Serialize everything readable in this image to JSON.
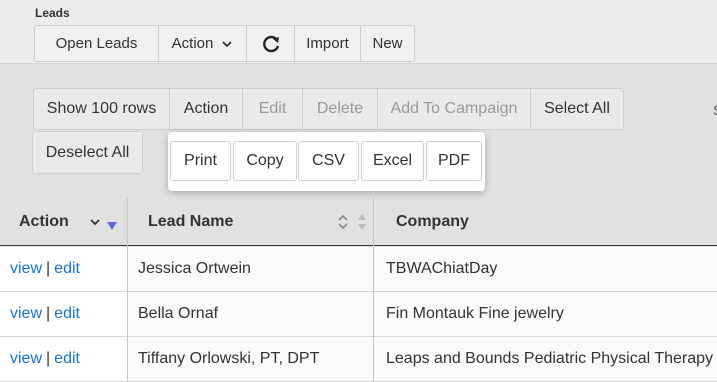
{
  "header": {
    "title": "Leads"
  },
  "top_toolbar": {
    "open_leads_label": "Open Leads",
    "action_label": "Action",
    "refresh_icon": "refresh-icon",
    "import_label": "Import",
    "new_label": "New"
  },
  "list_toolbar": {
    "show_rows_label": "Show 100 rows",
    "action_label": "Action",
    "edit_label": "Edit",
    "delete_label": "Delete",
    "add_to_campaign_label": "Add To Campaign",
    "select_all_label": "Select All",
    "deselect_all_label": "Deselect All",
    "partial_label": "S"
  },
  "export_menu": {
    "items": [
      "Print",
      "Copy",
      "CSV",
      "Excel",
      "PDF"
    ]
  },
  "table": {
    "columns": [
      "Action",
      "Lead Name",
      "Company"
    ],
    "view_label": "view",
    "edit_label": "edit",
    "separator": "|",
    "rows": [
      {
        "lead_name": "Jessica Ortwein",
        "company": "TBWAChiatDay"
      },
      {
        "lead_name": "Bella Ornaf",
        "company": "Fin Montauk Fine jewelry"
      },
      {
        "lead_name": "Tiffany Orlowski, PT, DPT",
        "company": "Leaps and Bounds Pediatric Physical Therapy"
      }
    ]
  },
  "colors": {
    "link": "#1a73c9",
    "sort_active": "#5b6bd8",
    "background": "#e1e1e1"
  }
}
